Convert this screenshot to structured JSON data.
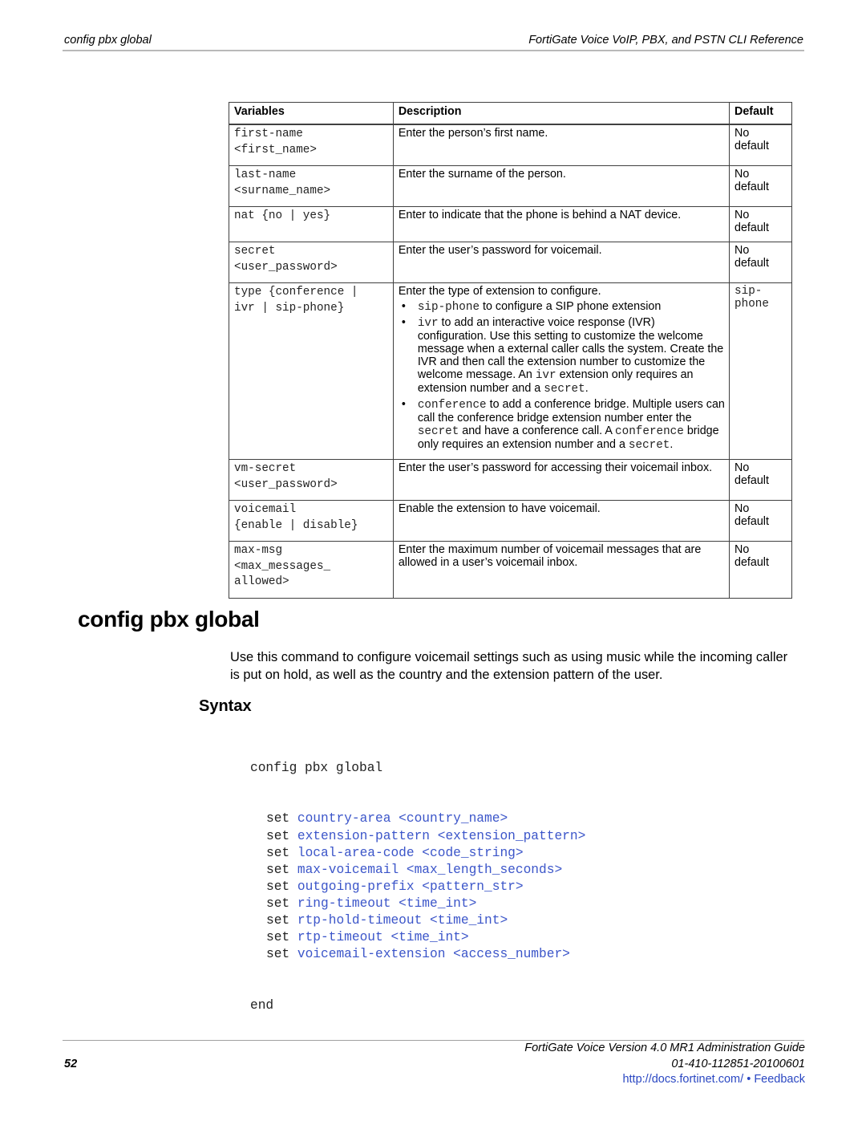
{
  "header": {
    "left": "config pbx global",
    "right": "FortiGate Voice VoIP, PBX, and PSTN CLI Reference"
  },
  "table": {
    "columns": [
      "Variables",
      "Description",
      "Default"
    ],
    "rows": [
      {
        "variable": [
          "first-name",
          "<first_name>"
        ],
        "description": "Enter the person’s first name.",
        "default": [
          "No",
          "default"
        ]
      },
      {
        "variable": [
          "last-name",
          "<surname_name>"
        ],
        "description": "Enter the surname of the person.",
        "default": [
          "No",
          "default"
        ]
      },
      {
        "variable": [
          "nat {no | yes}"
        ],
        "description": "Enter to indicate that the phone is behind a NAT device.",
        "default": [
          "No",
          "default"
        ]
      },
      {
        "variable": [
          "secret",
          "<user_password>"
        ],
        "description": "Enter the user’s password for voicemail.",
        "default": [
          "No",
          "default"
        ]
      },
      {
        "variable": [
          "type {conference |",
          "ivr | sip-phone}"
        ],
        "description": "Enter the type of extension to configure.",
        "bullets": [
          {
            "code": "sip-phone",
            "text": " to configure a SIP phone extension"
          },
          {
            "code": "ivr",
            "text": " to add an interactive voice response (IVR) configuration. Use this setting to customize the welcome message when a external caller calls the system. Create the IVR and then call the extension number to customize the welcome message. An ",
            "code2": "ivr",
            "text2": " extension only requires an extension number and a ",
            "code3": "secret",
            "text3": "."
          },
          {
            "code": "conference",
            "text": " to add a conference bridge. Multiple users can call the conference bridge extension number enter the ",
            "code2": "secret",
            "text2": " and have a conference call. A ",
            "code3": "conference",
            "text3": " bridge only requires an extension number and a ",
            "code4": "secret",
            "text4": "."
          }
        ],
        "default_code": [
          "sip-",
          "phone"
        ]
      },
      {
        "variable": [
          "vm-secret",
          "<user_password>"
        ],
        "description": "Enter the user’s password for accessing their voicemail inbox.",
        "default": [
          "No",
          "default"
        ]
      },
      {
        "variable": [
          "voicemail",
          "{enable | disable}"
        ],
        "description": "Enable the extension to have voicemail.",
        "default": [
          "No",
          "default"
        ]
      },
      {
        "variable": [
          "max-msg",
          "<max_messages_",
          "allowed>"
        ],
        "description": "Enter the maximum number of voicemail messages that are allowed in a user’s voicemail inbox.",
        "default": [
          "No",
          "default"
        ]
      }
    ]
  },
  "section": {
    "title": "config pbx global",
    "intro": "Use this command to configure voicemail settings such as using music while the incoming caller is put on hold, as well as the country and the extension pattern of the user.",
    "syntax_heading": "Syntax"
  },
  "syntax": {
    "open": "config pbx global",
    "set_keyword": "set",
    "lines": [
      "country-area <country_name>",
      "extension-pattern <extension_pattern>",
      "local-area-code <code_string>",
      "max-voicemail <max_length_seconds>",
      "outgoing-prefix <pattern_str>",
      "ring-timeout <time_int>",
      "rtp-hold-timeout <time_int>",
      "rtp-timeout <time_int>",
      "voicemail-extension <access_number>"
    ],
    "close": "end"
  },
  "footer": {
    "page_number": "52",
    "guide_title": "FortiGate Voice Version 4.0 MR1 Administration Guide",
    "doc_id": "01-410-112851-20100601",
    "link": "http://docs.fortinet.com/",
    "separator": " • ",
    "feedback": "Feedback"
  },
  "colors": {
    "link_blue": "#3b55c9",
    "rule_gray": "#b9b9b9"
  }
}
